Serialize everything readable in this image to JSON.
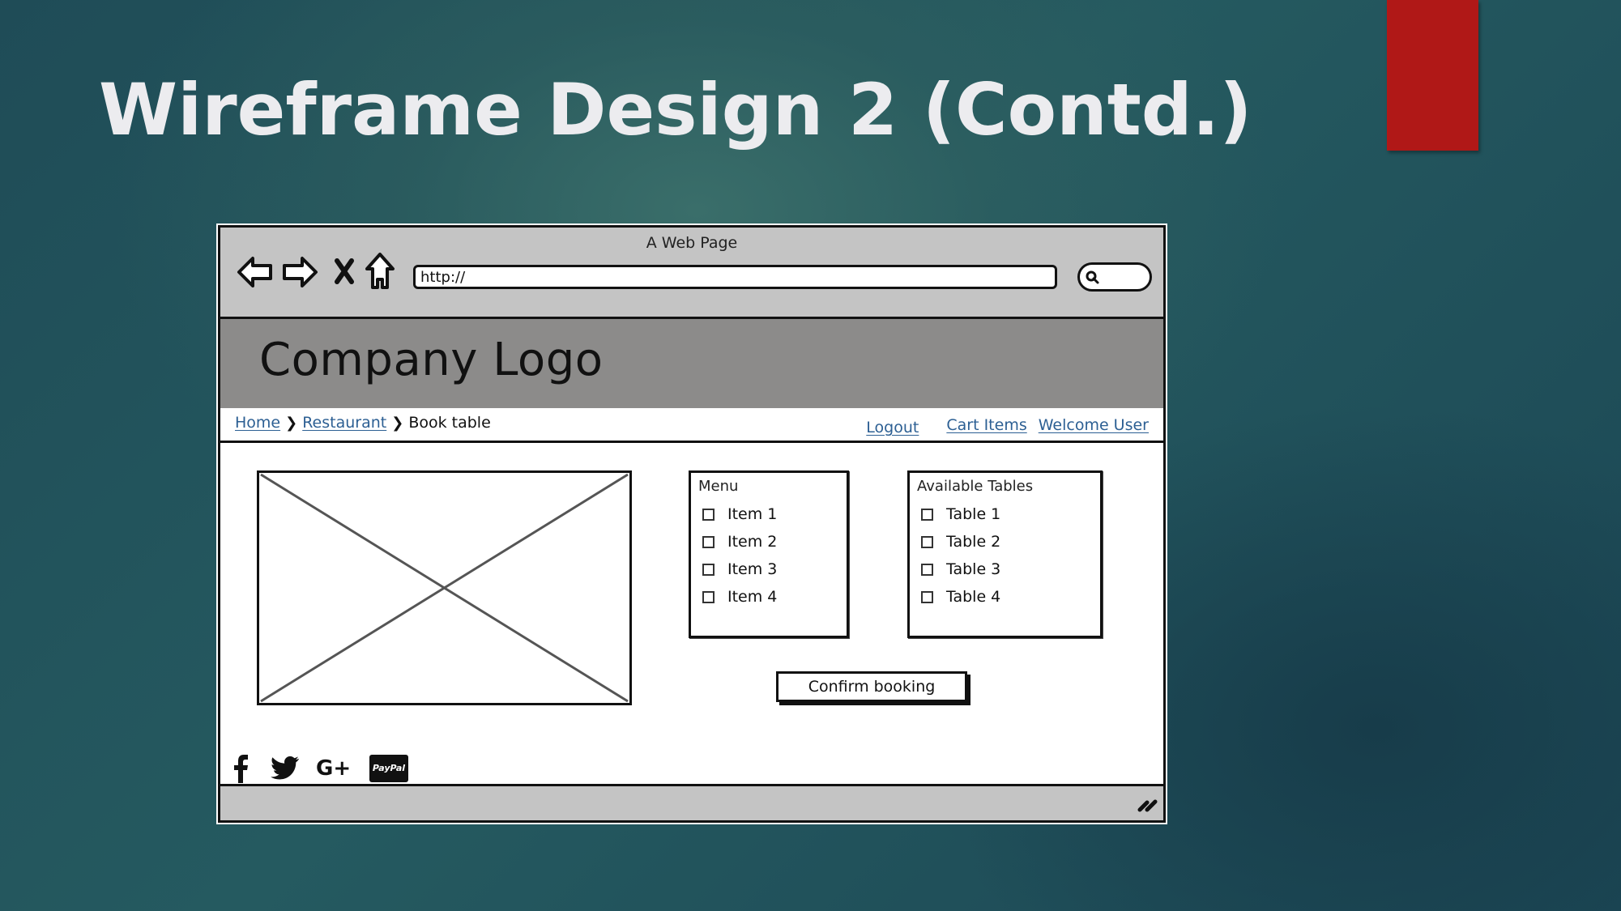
{
  "slide": {
    "title": "Wireframe Design 2 (Contd.)",
    "accent_color": "#b01817"
  },
  "browser": {
    "window_title": "A Web Page",
    "nav_icons": [
      "back-arrow-icon",
      "forward-arrow-icon",
      "stop-icon",
      "home-icon"
    ],
    "url": "http://",
    "search_icon": "search-icon"
  },
  "header": {
    "logo_text": "Company Logo"
  },
  "breadcrumb": {
    "items": [
      {
        "label": "Home",
        "link": true
      },
      {
        "label": "Restaurant",
        "link": true
      },
      {
        "label": "Book table",
        "link": false
      }
    ],
    "separator": "❯"
  },
  "top_links": [
    {
      "label": "Logout"
    },
    {
      "label": "Cart Items"
    },
    {
      "label": "Welcome User"
    }
  ],
  "image_placeholder": "image-placeholder",
  "menu_panel": {
    "title": "Menu",
    "items": [
      {
        "label": "Item 1",
        "checked": false
      },
      {
        "label": "Item 2",
        "checked": false
      },
      {
        "label": "Item 3",
        "checked": false
      },
      {
        "label": "Item 4",
        "checked": false
      }
    ]
  },
  "tables_panel": {
    "title": "Available Tables",
    "items": [
      {
        "label": "Table 1",
        "checked": false
      },
      {
        "label": "Table 2",
        "checked": false
      },
      {
        "label": "Table 3",
        "checked": false
      },
      {
        "label": "Table 4",
        "checked": false
      }
    ]
  },
  "confirm_button": {
    "label": "Confirm booking"
  },
  "social": {
    "icons": [
      "facebook-icon",
      "twitter-icon",
      "google-plus-icon",
      "paypal-icon"
    ],
    "google_plus_text": "G+",
    "paypal_text": "PayPal"
  },
  "colors": {
    "link": "#2c5f93",
    "chrome_gray": "#c4c4c4",
    "header_gray": "#8c8b8a"
  }
}
